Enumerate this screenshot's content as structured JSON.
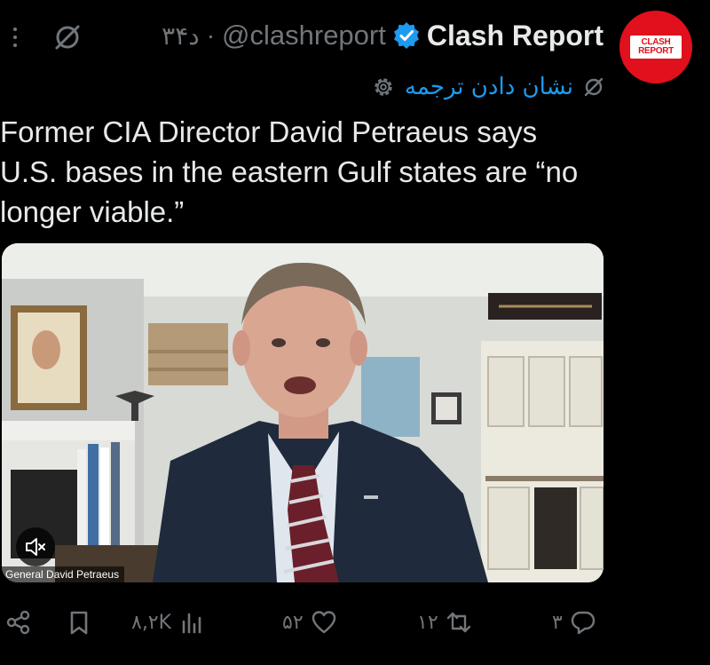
{
  "header": {
    "display_name": "Clash Report",
    "handle": "@clashreport",
    "separator": "·",
    "time": "۳۴د",
    "avatar_logo_line1": "CLASH",
    "avatar_logo_line2": "REPORT",
    "translate_label": "نشان دادن ترجمه"
  },
  "tweet": {
    "text": "Former CIA Director David Petraeus says\nU.S. bases in the eastern Gulf states are “no\nlonger viable.”"
  },
  "media": {
    "caption": "General David Petraeus"
  },
  "actions": {
    "replies": "۳",
    "reposts": "۱۲",
    "likes": "۵۲",
    "views": "۸,۲K"
  },
  "colors": {
    "background": "#000000",
    "text": "#e7e9ea",
    "muted": "#71767b",
    "accent": "#1d9bf0",
    "brand_red": "#e0101c"
  },
  "icons": {
    "more": "more-dots-icon",
    "grok": "grok-icon",
    "verified": "verified-badge-icon",
    "translate": "translate-icon",
    "settings": "gear-icon",
    "mute": "muted-speaker-icon",
    "share": "share-icon",
    "bookmark": "bookmark-icon",
    "views": "views-chart-icon",
    "like": "heart-icon",
    "repost": "repost-icon",
    "reply": "reply-icon"
  }
}
